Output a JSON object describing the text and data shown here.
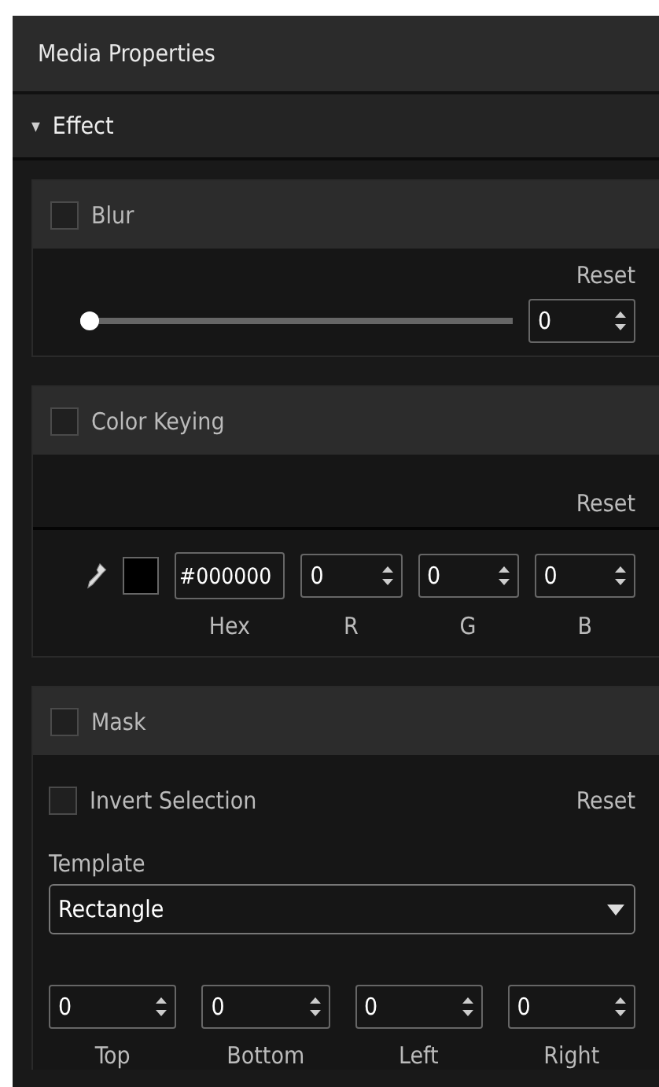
{
  "panel": {
    "title": "Media Properties"
  },
  "group": {
    "label": "Effect",
    "expanded": true,
    "toggle": "▾"
  },
  "blur": {
    "label": "Blur",
    "checked": false,
    "reset": "Reset",
    "slider": {
      "level": 0
    },
    "value": "0"
  },
  "color_keying": {
    "label": "Color Keying",
    "checked": false,
    "reset": "Reset",
    "hex": "#000000",
    "fields": [
      {
        "label": "R",
        "value": "0"
      },
      {
        "label": "G",
        "value": "0"
      },
      {
        "label": "B",
        "value": "0"
      }
    ],
    "hex_label": "Hex"
  },
  "mask": {
    "label": "Mask",
    "checked": false,
    "invert": {
      "label": "Invert Selection",
      "checked": false
    },
    "reset": "Reset",
    "template_label": "Template",
    "template": "Rectangle",
    "fields": [
      {
        "label": "Top",
        "value": "0"
      },
      {
        "label": "Bottom",
        "value": "0"
      },
      {
        "label": "Left",
        "value": "0"
      },
      {
        "label": "Right",
        "value": "0"
      }
    ]
  }
}
